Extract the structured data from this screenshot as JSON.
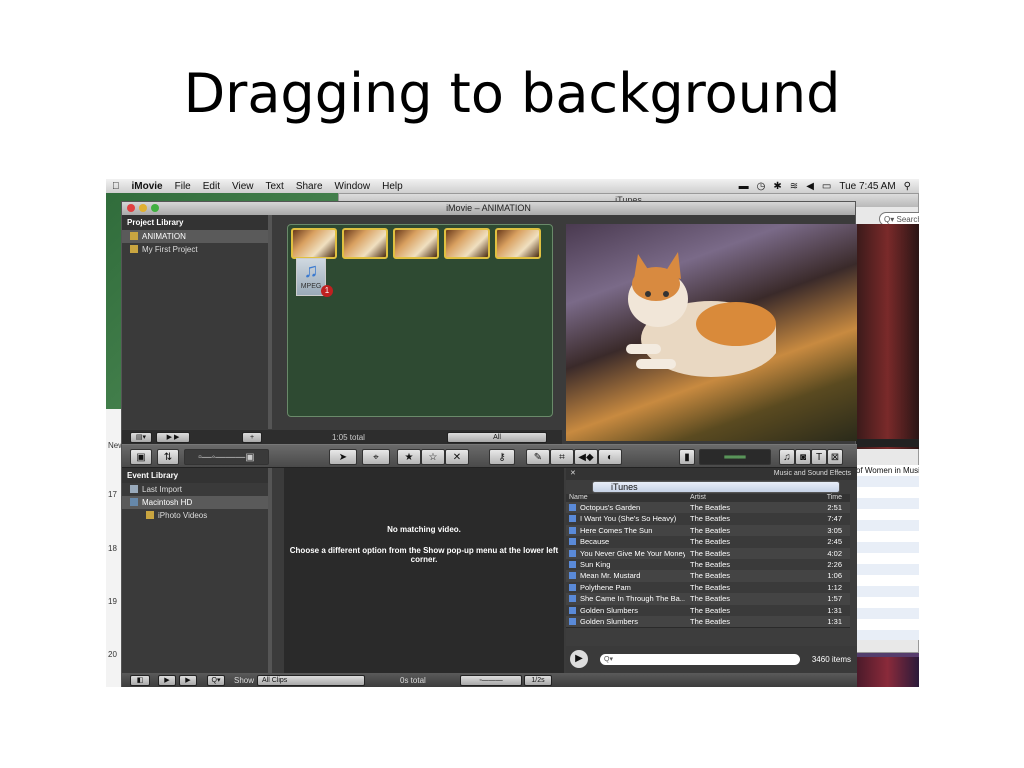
{
  "slide": {
    "title": "Dragging to background"
  },
  "menubar": {
    "app": "iMovie",
    "items": [
      "File",
      "Edit",
      "View",
      "Text",
      "Share",
      "Window",
      "Help"
    ],
    "clock": "Tue 7:45 AM"
  },
  "itunes": {
    "title": "iTunes",
    "search_placeholder": "Search",
    "list_header": "of Women in Music"
  },
  "desktop_calendar": {
    "numbers": [
      "17",
      "18",
      "19",
      "20"
    ],
    "label": "New"
  },
  "imovie": {
    "title": "iMovie – ANIMATION",
    "project_library": {
      "heading": "Project Library",
      "items": [
        {
          "label": "ANIMATION",
          "selected": true
        },
        {
          "label": "My First Project",
          "selected": false
        }
      ]
    },
    "project_area": {
      "mpeg_label": "MPEG",
      "mpeg_count": "1"
    },
    "project_bar": {
      "total": "1:05 total",
      "zoom_label": "All"
    },
    "event_library": {
      "heading": "Event Library",
      "items": [
        {
          "label": "Last Import"
        },
        {
          "label": "Macintosh HD"
        },
        {
          "label": "iPhoto Videos"
        }
      ]
    },
    "event_area": {
      "message_title": "No matching video.",
      "message_body": "Choose a different option from the Show pop-up menu at the lower left corner."
    },
    "music": {
      "heading": "Music and Sound Effects",
      "source": "iTunes",
      "columns": {
        "name": "Name",
        "artist": "Artist",
        "time": "Time"
      },
      "rows": [
        {
          "name": "Octopus's Garden",
          "artist": "The Beatles",
          "time": "2:51"
        },
        {
          "name": "I Want You (She's So Heavy)",
          "artist": "The Beatles",
          "time": "7:47"
        },
        {
          "name": "Here Comes The Sun",
          "artist": "The Beatles",
          "time": "3:05"
        },
        {
          "name": "Because",
          "artist": "The Beatles",
          "time": "2:45"
        },
        {
          "name": "You Never Give Me Your Money",
          "artist": "The Beatles",
          "time": "4:02"
        },
        {
          "name": "Sun King",
          "artist": "The Beatles",
          "time": "2:26"
        },
        {
          "name": "Mean Mr. Mustard",
          "artist": "The Beatles",
          "time": "1:06"
        },
        {
          "name": "Polythene Pam",
          "artist": "The Beatles",
          "time": "1:12"
        },
        {
          "name": "She Came In Through The Ba...",
          "artist": "The Beatles",
          "time": "1:57"
        },
        {
          "name": "Golden Slumbers",
          "artist": "The Beatles",
          "time": "1:31"
        },
        {
          "name": "Golden Slumbers",
          "artist": "The Beatles",
          "time": "1:31"
        }
      ],
      "item_count": "3460 items"
    },
    "bottom_bar": {
      "show_label": "Show",
      "show_value": "All Clips",
      "total": "0s total",
      "zoom": "1/2s"
    }
  }
}
